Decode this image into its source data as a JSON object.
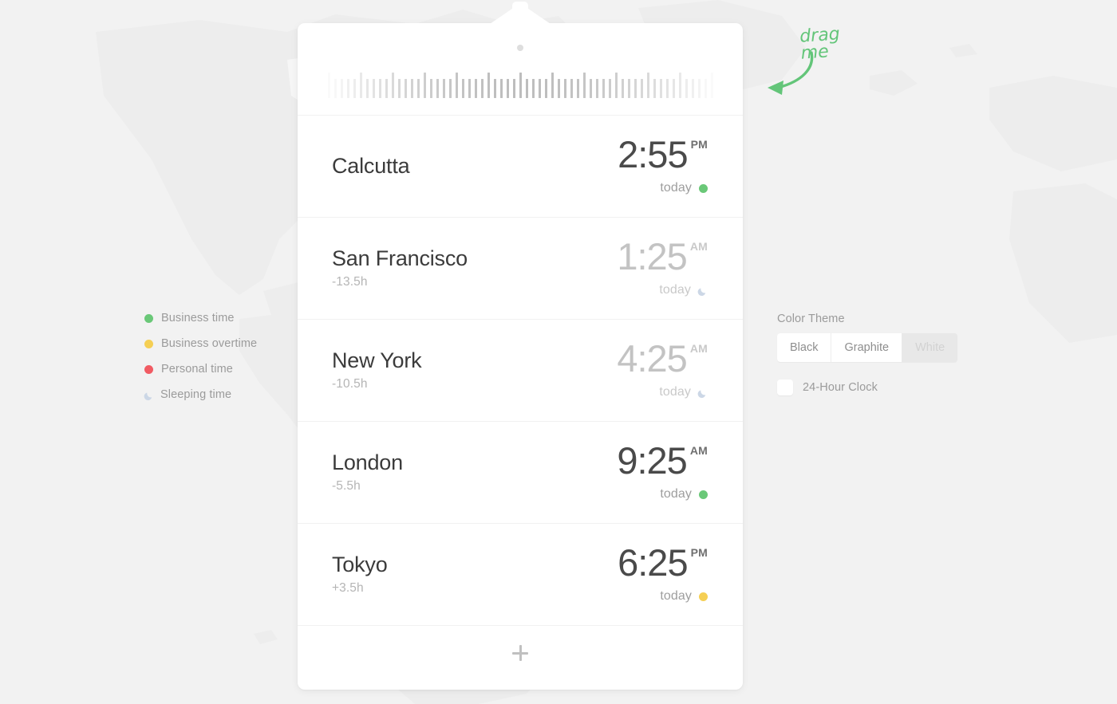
{
  "annotation": {
    "drag_me_text": "drag me",
    "drag_me_color": "#63c579"
  },
  "legend": {
    "items": [
      {
        "label": "Business time",
        "icon": "dot",
        "color": "#6ac878"
      },
      {
        "label": "Business overtime",
        "icon": "dot",
        "color": "#f5cf54"
      },
      {
        "label": "Personal time",
        "icon": "dot",
        "color": "#f15b63"
      },
      {
        "label": "Sleeping time",
        "icon": "moon-icon",
        "color": "#ccd7e6"
      }
    ]
  },
  "settings": {
    "color_theme_label": "Color Theme",
    "theme_options": [
      {
        "label": "Black",
        "selected": false
      },
      {
        "label": "Graphite",
        "selected": false
      },
      {
        "label": "White",
        "selected": true
      }
    ],
    "clock_24_label": "24-Hour Clock",
    "clock_24_checked": false
  },
  "card": {
    "add_city_icon": "plus-icon",
    "slider": {
      "handle_icon": "slider-knob-dot",
      "tick_total": 61,
      "tall_every": 5
    },
    "cities": [
      {
        "name": "Calcutta",
        "offset": "",
        "time": "2:55",
        "meridiem": "PM",
        "day": "today",
        "status_icon": "dot",
        "status_color": "#6ac878",
        "dimmed": false
      },
      {
        "name": "San Francisco",
        "offset": "-13.5h",
        "time": "1:25",
        "meridiem": "AM",
        "day": "today",
        "status_icon": "moon-icon",
        "status_color": "#ccd7e6",
        "dimmed": true
      },
      {
        "name": "New York",
        "offset": "-10.5h",
        "time": "4:25",
        "meridiem": "AM",
        "day": "today",
        "status_icon": "moon-icon",
        "status_color": "#ccd7e6",
        "dimmed": true
      },
      {
        "name": "London",
        "offset": "-5.5h",
        "time": "9:25",
        "meridiem": "AM",
        "day": "today",
        "status_icon": "dot",
        "status_color": "#6ac878",
        "dimmed": false
      },
      {
        "name": "Tokyo",
        "offset": "+3.5h",
        "time": "6:25",
        "meridiem": "PM",
        "day": "today",
        "status_icon": "dot",
        "status_color": "#f5cf54",
        "dimmed": false
      }
    ]
  }
}
